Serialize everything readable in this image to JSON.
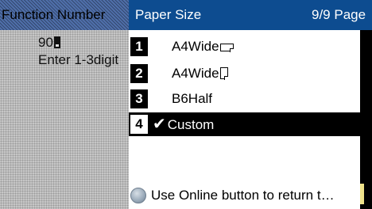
{
  "left_panel": {
    "header": "Function Number",
    "input_value": "90",
    "hint": "Enter 1-3digit"
  },
  "popup": {
    "title": "Paper Size",
    "page_indicator": "9/9 Page",
    "items": [
      {
        "number": "1",
        "label": "A4Wide",
        "icon": "landscape-orientation-icon"
      },
      {
        "number": "2",
        "label": "A4Wide",
        "icon": "portrait-orientation-icon"
      },
      {
        "number": "3",
        "label": "B6Half"
      },
      {
        "number": "4",
        "label": "Custom",
        "selected": true,
        "check": "✔"
      }
    ],
    "footer_hint": "Use Online button to return t…"
  },
  "colors": {
    "popup_header": "#0d4c90",
    "left_header": "#4f6faa",
    "left_panel": "#c6c6c6",
    "selection": "#000000",
    "accent": "#efe28a"
  }
}
